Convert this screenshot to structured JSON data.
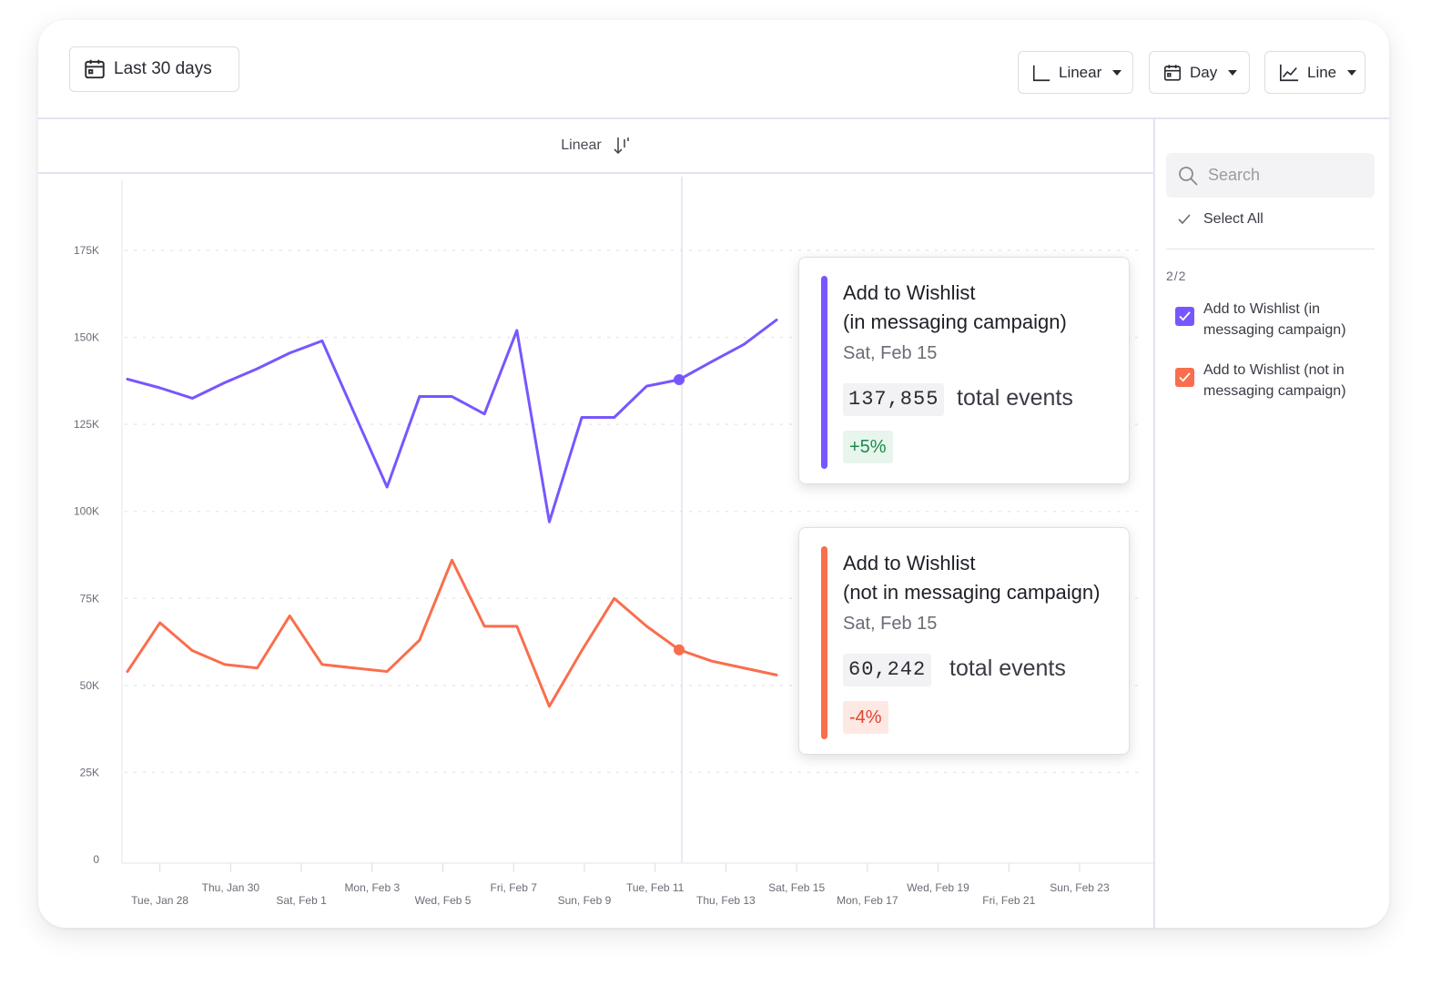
{
  "toolbar": {
    "range_label": "Last 30 days",
    "scale_label": "Linear",
    "unit_label": "Day",
    "type_label": "Line"
  },
  "subheader": {
    "label": "Linear"
  },
  "colors": {
    "series_a": "#7856ff",
    "series_b": "#f96e4d",
    "positive": "#1d8a4c",
    "negative": "#e0452f"
  },
  "tooltips": [
    {
      "title": "Add to Wishlist",
      "subtitle": "(in messaging campaign)",
      "date": "Sat, Feb 15",
      "value": "137,855",
      "unit": "total events",
      "delta": "+5%"
    },
    {
      "title": "Add to Wishlist",
      "subtitle": "(not in messaging campaign)",
      "date": "Sat, Feb 15",
      "value": "60,242",
      "unit": "total events",
      "delta": "-4%"
    }
  ],
  "sidebar": {
    "search_placeholder": "Search",
    "select_all": "Select All",
    "count": "2/2",
    "items": [
      {
        "label": "Add to Wishlist (in messaging campaign)"
      },
      {
        "label": "Add to Wishlist (not in messaging campaign)"
      }
    ]
  },
  "chart_data": {
    "type": "line",
    "ylim": [
      0,
      175000
    ],
    "y_ticks": [
      0,
      25000,
      50000,
      75000,
      100000,
      125000,
      150000,
      175000
    ],
    "y_tick_labels": [
      "0",
      "25K",
      "50K",
      "75K",
      "100K",
      "125K",
      "150K",
      "175K"
    ],
    "x_tick_labels": [
      "Tue, Jan 28",
      "Thu, Jan 30",
      "Sat, Feb 1",
      "Mon, Feb 3",
      "Wed, Feb 5",
      "Fri, Feb 7",
      "Sun, Feb 9",
      "Tue, Feb 11",
      "Thu, Feb 13",
      "Sat, Feb 15",
      "Mon, Feb 17",
      "Wed, Feb 19",
      "Fri, Feb 21",
      "Sun, Feb 23"
    ],
    "x": [
      "Jan 27",
      "Jan 28",
      "Jan 29",
      "Jan 30",
      "Jan 31",
      "Feb 1",
      "Feb 2",
      "Feb 3",
      "Feb 4",
      "Feb 5",
      "Feb 6",
      "Feb 7",
      "Feb 8",
      "Feb 9",
      "Feb 10",
      "Feb 11",
      "Feb 12",
      "Feb 13",
      "Feb 14",
      "Feb 15",
      "Feb 16"
    ],
    "series": [
      {
        "name": "Add to Wishlist (in messaging campaign)",
        "values": [
          138000,
          135500,
          132500,
          137000,
          141000,
          145500,
          149000,
          128000,
          107000,
          133000,
          133000,
          128000,
          152000,
          97000,
          127000,
          127000,
          136000,
          137855,
          143000,
          148000,
          155000
        ]
      },
      {
        "name": "Add to Wishlist (not in messaging campaign)",
        "values": [
          54000,
          68000,
          60000,
          56000,
          55000,
          70000,
          56000,
          55000,
          54000,
          63000,
          86000,
          67000,
          67000,
          44000,
          60000,
          75000,
          67000,
          60242,
          57000,
          55000,
          53000
        ]
      }
    ],
    "focus_index": 17,
    "grid": true
  }
}
